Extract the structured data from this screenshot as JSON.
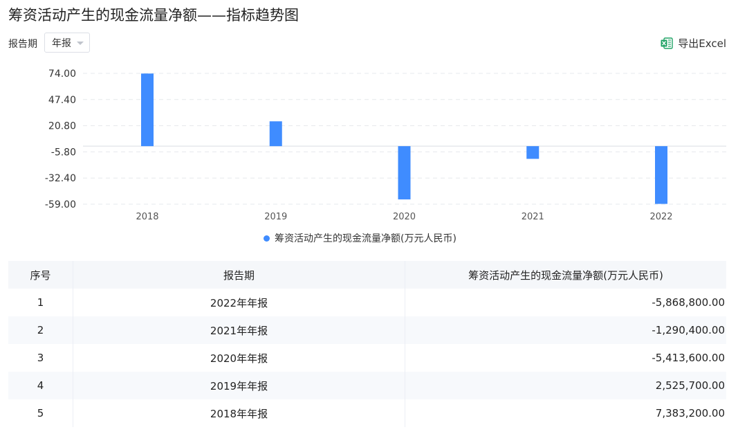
{
  "page": {
    "title": "筹资活动产生的现金流量净额——指标趋势图"
  },
  "toolbar": {
    "period_label": "报告期",
    "period_value": "年报",
    "export_label": "导出Excel",
    "export_icon": "excel-icon"
  },
  "colors": {
    "bar": "#3f8cff",
    "excel_green": "#21a366"
  },
  "chart_data": {
    "type": "bar",
    "categories": [
      "2018",
      "2019",
      "2020",
      "2021",
      "2022"
    ],
    "series": [
      {
        "name": "筹资活动产生的现金流量净额(万元人民币)",
        "values": [
          73.83,
          25.26,
          -54.14,
          -12.9,
          -58.69
        ]
      }
    ],
    "yticks": [
      74.0,
      47.4,
      20.8,
      -5.8,
      -32.4,
      -59.0
    ],
    "ytick_labels": [
      "74.00",
      "47.40",
      "20.80",
      "-5.80",
      "-32.40",
      "-59.00"
    ],
    "ylim": [
      -59.0,
      74.0
    ],
    "grid": "dashed-horizontal",
    "legend": "bottom-center"
  },
  "table": {
    "headers": [
      "序号",
      "报告期",
      "筹资活动产生的现金流量净额(万元人民币)"
    ],
    "rows": [
      [
        "1",
        "2022年年报",
        "-5,868,800.00"
      ],
      [
        "2",
        "2021年年报",
        "-1,290,400.00"
      ],
      [
        "3",
        "2020年年报",
        "-5,413,600.00"
      ],
      [
        "4",
        "2019年年报",
        "2,525,700.00"
      ],
      [
        "5",
        "2018年年报",
        "7,383,200.00"
      ]
    ]
  }
}
